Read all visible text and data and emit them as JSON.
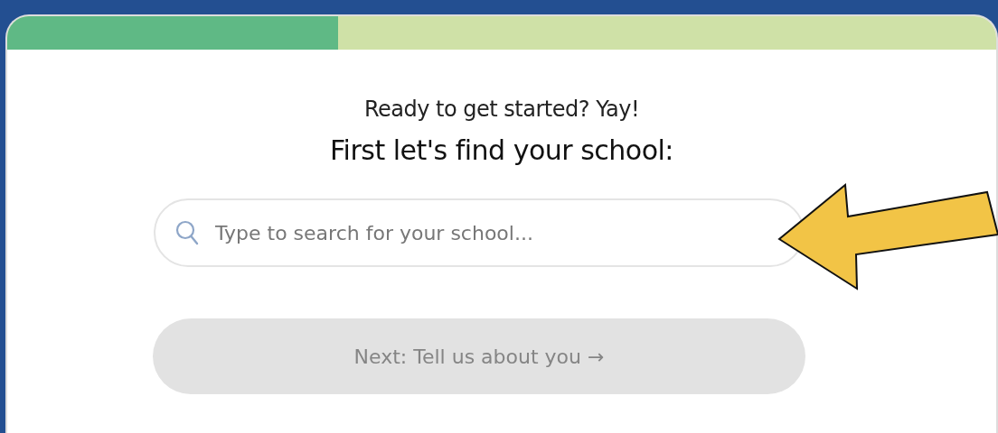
{
  "progress": {
    "level": 0.335
  },
  "subtitle": "Ready to get started? Yay!",
  "heading": "First let's find your school:",
  "search": {
    "placeholder": "Type to search for your school..."
  },
  "next_button": {
    "label": "Next: Tell us about you →",
    "disabled": true
  }
}
